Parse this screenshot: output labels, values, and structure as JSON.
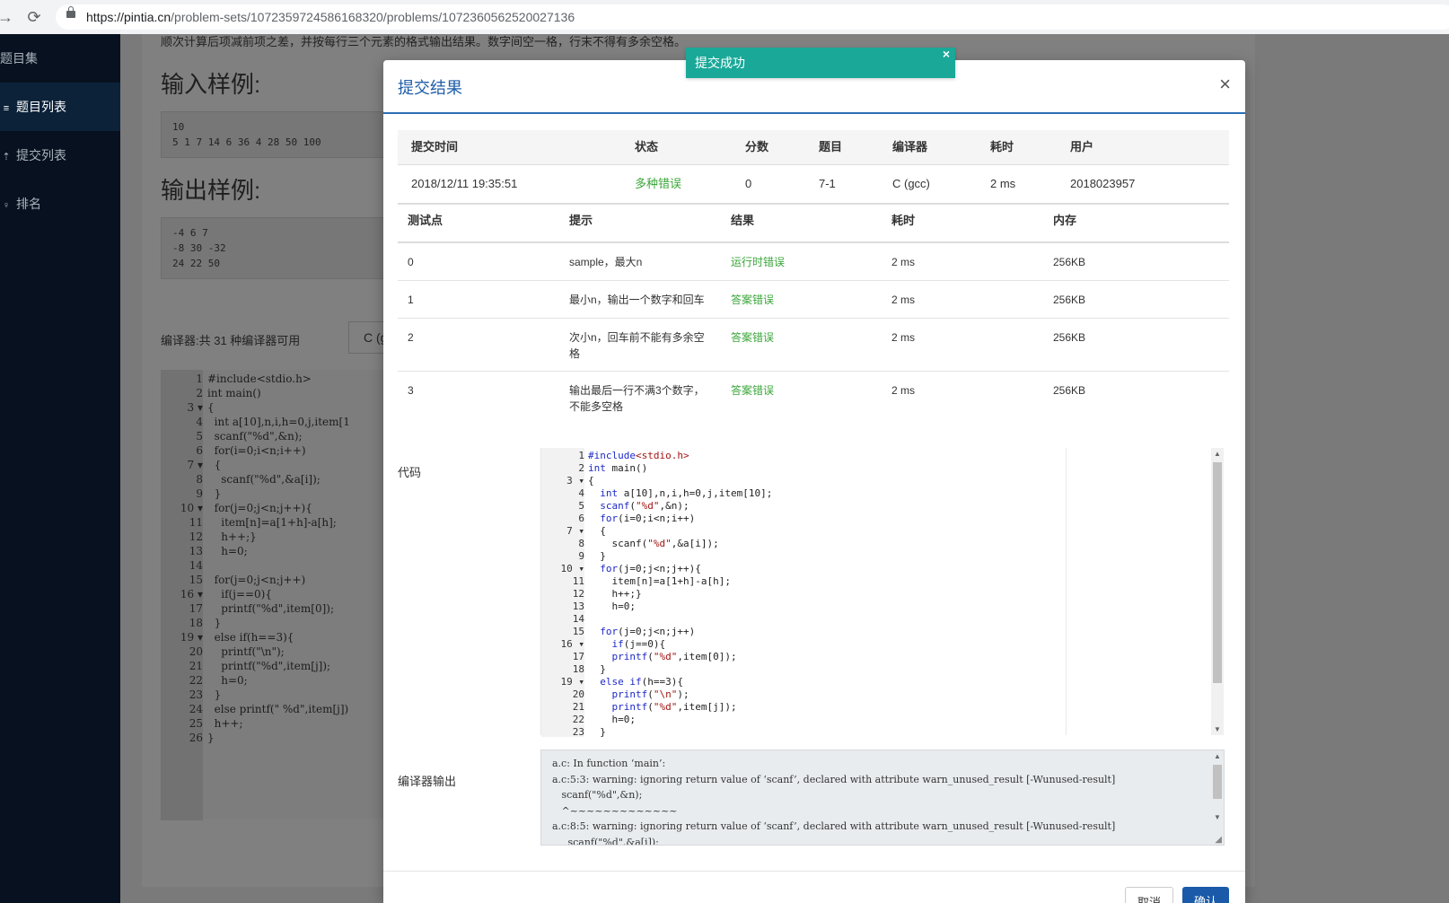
{
  "browser": {
    "url_host": "https://pintia.cn",
    "url_path": "/problem-sets/1072359724586168320/problems/1072360562520027136"
  },
  "sidebar": {
    "items": [
      {
        "label": "题目集"
      },
      {
        "label": "题目列表"
      },
      {
        "label": "提交列表"
      },
      {
        "label": "排名"
      }
    ]
  },
  "background": {
    "desc_text": "顺次计算后项减前项之差，并按每行三个元素的格式输出结果。数字间空一格，行末不得有多余空格。",
    "input_heading": "输入样例:",
    "input_sample": "10\n5 1 7 14 6 36 4 28 50 100",
    "output_heading": "输出样例:",
    "output_sample": "-4 6 7\n-8 30 -32\n24 22 50",
    "compiler_label": "编译器:共 31 种编译器可用",
    "compiler_select": "C (g",
    "editor_line_numbers": "1\n2\n3 ▾\n4\n5\n6\n7 ▾\n8\n9\n10 ▾\n11\n12\n13\n14\n15\n16 ▾\n17\n18\n19 ▾\n20\n21\n22\n23\n24\n25\n26",
    "editor_code": "#include<stdio.h>\nint main()\n{\n  int a[10],n,i,h=0,j,item[1\n  scanf(\"%d\",&n);\n  for(i=0;i<n;i++)\n  {\n    scanf(\"%d\",&a[i]);\n  }\n  for(j=0;j<n;j++){\n    item[n]=a[1+h]-a[h];\n    h++;}\n    h=0;\n\n  for(j=0;j<n;j++)\n    if(j==0){\n    printf(\"%d\",item[0]);\n  }\n  else if(h==3){\n    printf(\"\\n\");\n    printf(\"%d\",item[j]);\n    h=0;\n  }\n  else printf(\" %d\",item[j])\n  h++;\n}"
  },
  "toast": {
    "text": "提交成功",
    "close": "×"
  },
  "modal": {
    "title": "提交结果",
    "close": "×",
    "summary_headers": [
      "提交时间",
      "状态",
      "分数",
      "题目",
      "编译器",
      "耗时",
      "用户"
    ],
    "summary_row": [
      "2018/12/11 19:35:51",
      "多种错误",
      "0",
      "7-1",
      "C (gcc)",
      "2 ms",
      "2018023957"
    ],
    "test_headers": [
      "测试点",
      "提示",
      "结果",
      "耗时",
      "内存"
    ],
    "test_rows": [
      {
        "id": "0",
        "hint": "sample，最大n",
        "result": "运行时错误",
        "time": "2 ms",
        "memory": "256KB"
      },
      {
        "id": "1",
        "hint": "最小n，输出一个数字和回车",
        "result": "答案错误",
        "time": "2 ms",
        "memory": "256KB"
      },
      {
        "id": "2",
        "hint": "次小n，回车前不能有多余空\n格",
        "result": "答案错误",
        "time": "2 ms",
        "memory": "256KB"
      },
      {
        "id": "3",
        "hint": "输出最后一行不满3个数字，\n不能多空格",
        "result": "答案错误",
        "time": "2 ms",
        "memory": "256KB"
      }
    ],
    "code_label": "代码",
    "compiler_output_label": "编译器输出",
    "code_line_numbers": "1\n2\n3 ▾\n4\n5\n6\n7 ▾\n8\n9\n10 ▾\n11\n12\n13\n14\n15\n16 ▾\n17\n18\n19 ▾\n20\n21\n22\n23",
    "compiler_output": "a.c: In function ‘main’:\na.c:5:3: warning: ignoring return value of ‘scanf’, declared with attribute warn_unused_result [-Wunused-result]\n   scanf(\"%d\",&n);\n   ^~~~~~~~~~~~~~\na.c:8:5: warning: ignoring return value of ‘scanf’, declared with attribute warn_unused_result [-Wunused-result]\n     scanf(\"%d\",&a[i]);",
    "cancel_label": "取消",
    "ok_label": "确认"
  },
  "colors": {
    "accent": "#1f5ea8",
    "status_green": "#3aa63a",
    "toast": "#1aa899",
    "sidebar": "#07111f"
  }
}
